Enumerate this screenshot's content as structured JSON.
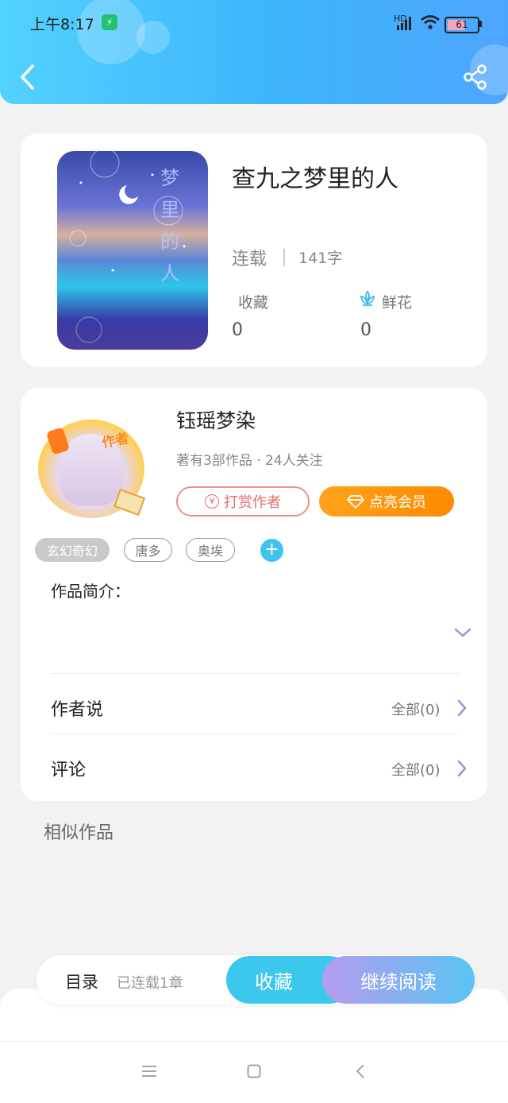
{
  "status_bar": {
    "time": "上午8:17",
    "network": "HD",
    "battery": "61",
    "battery_level": 0.61
  },
  "book": {
    "title": "查九之梦里的人",
    "status": "连载",
    "word_count": "141字",
    "cover_text": "梦里的人",
    "favorites_label": "收藏",
    "favorites_value": "0",
    "flowers_label": "鲜花",
    "flowers_value": "0"
  },
  "author": {
    "badge": "作者",
    "name": "钰瑶梦染",
    "meta": "著有3部作品 · 24人关注",
    "tip_button": "打赏作者",
    "tip_icon": "¥",
    "vip_button": "点亮会员"
  },
  "tags": [
    "玄幻奇幻",
    "唐多",
    "奥埃"
  ],
  "intro_label": "作品简介：",
  "rows": {
    "author_says": {
      "label": "作者说",
      "right": "全部(0)"
    },
    "comments": {
      "label": "评论",
      "right": "全部(0)"
    }
  },
  "similar_label": "相似作品",
  "bottom_bar": {
    "catalog": "目录",
    "progress": "已连载1章",
    "collect": "收藏",
    "continue": "继续阅读"
  },
  "colors": {
    "accent": "#3cc8ec",
    "vip_orange": "#ff8a00",
    "purple": "#b59cf0"
  }
}
